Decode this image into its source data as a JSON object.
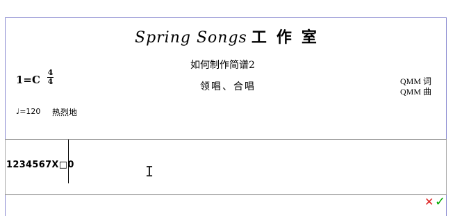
{
  "header": {
    "studio_name": "Spring Songs",
    "studio_suffix": "工作室",
    "song_title": "如何制作简谱2",
    "singers": "领唱、合唱",
    "key": "1=C",
    "time_sig_top": "4",
    "time_sig_bottom": "4",
    "lyricist": "QMM 词",
    "composer": "QMM 曲",
    "tempo": "♩=120",
    "mood": "热烈地"
  },
  "editor": {
    "input_text": "1234567X□0"
  },
  "actions": {
    "cancel_icon": "✕",
    "confirm_icon": "✓"
  },
  "colors": {
    "page_border": "#8a8ad0",
    "cancel": "#dd2222",
    "confirm": "#00aa00"
  }
}
